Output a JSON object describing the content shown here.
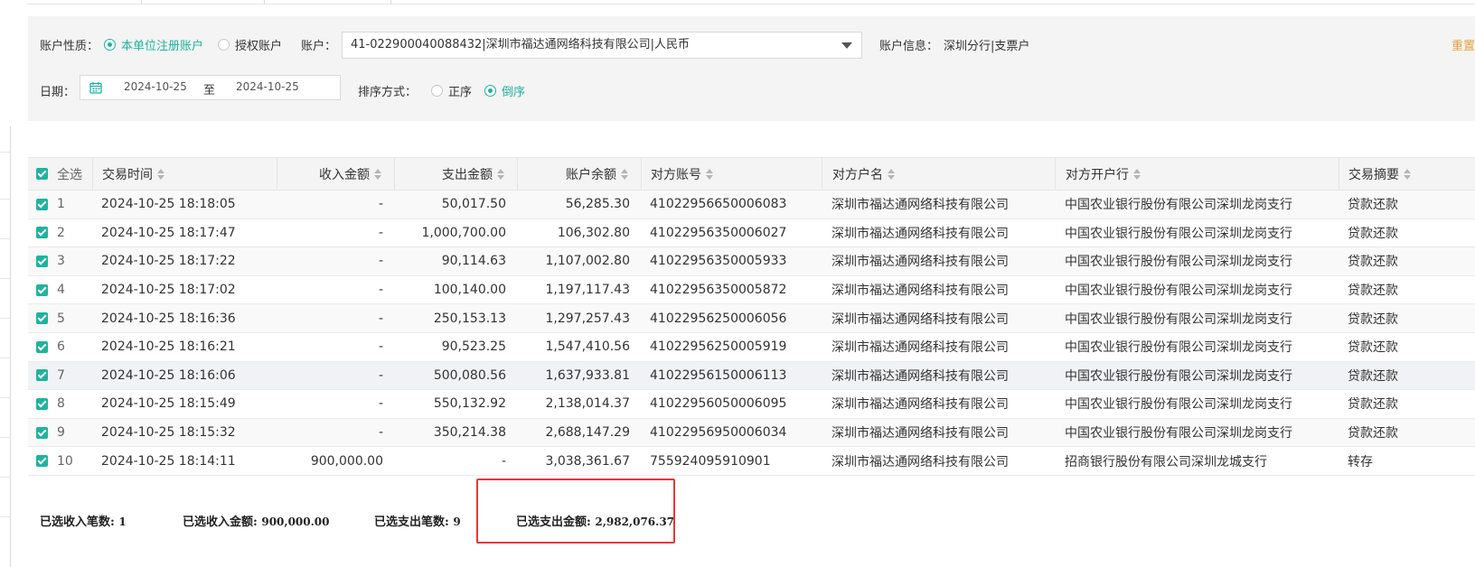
{
  "filters": {
    "account_type_label": "账户性质：",
    "account_type_options": [
      {
        "label": "本单位注册账户",
        "selected": true
      },
      {
        "label": "授权账户",
        "selected": false
      }
    ],
    "account_label": "账户：",
    "account_value": "41-022900040088432|深圳市福达通网络科技有限公司|人民币",
    "account_info_label": "账户信息：",
    "account_info_value": "深圳分行|支票户",
    "reset_label": "重置",
    "date_label": "日期：",
    "date_start": "2024-10-25",
    "date_to": "至",
    "date_end": "2024-10-25",
    "sort_label": "排序方式：",
    "sort_options": [
      {
        "label": "正序",
        "selected": false
      },
      {
        "label": "倒序",
        "selected": true
      }
    ]
  },
  "table": {
    "select_all_label": "全选",
    "columns": [
      "交易时间",
      "收入金额",
      "支出金额",
      "账户余额",
      "对方账号",
      "对方户名",
      "对方开户行",
      "交易摘要"
    ],
    "rows": [
      {
        "no": "1",
        "time": "2024-10-25 18:18:05",
        "income": "-",
        "expense": "50,017.50",
        "balance": "56,285.30",
        "acct": "41022956650006083",
        "name": "深圳市福达通网络科技有限公司",
        "bank": "中国农业银行股份有限公司深圳龙岗支行",
        "memo": "贷款还款"
      },
      {
        "no": "2",
        "time": "2024-10-25 18:17:47",
        "income": "-",
        "expense": "1,000,700.00",
        "balance": "106,302.80",
        "acct": "41022956350006027",
        "name": "深圳市福达通网络科技有限公司",
        "bank": "中国农业银行股份有限公司深圳龙岗支行",
        "memo": "贷款还款"
      },
      {
        "no": "3",
        "time": "2024-10-25 18:17:22",
        "income": "-",
        "expense": "90,114.63",
        "balance": "1,107,002.80",
        "acct": "41022956350005933",
        "name": "深圳市福达通网络科技有限公司",
        "bank": "中国农业银行股份有限公司深圳龙岗支行",
        "memo": "贷款还款"
      },
      {
        "no": "4",
        "time": "2024-10-25 18:17:02",
        "income": "-",
        "expense": "100,140.00",
        "balance": "1,197,117.43",
        "acct": "41022956350005872",
        "name": "深圳市福达通网络科技有限公司",
        "bank": "中国农业银行股份有限公司深圳龙岗支行",
        "memo": "贷款还款"
      },
      {
        "no": "5",
        "time": "2024-10-25 18:16:36",
        "income": "-",
        "expense": "250,153.13",
        "balance": "1,297,257.43",
        "acct": "41022956250006056",
        "name": "深圳市福达通网络科技有限公司",
        "bank": "中国农业银行股份有限公司深圳龙岗支行",
        "memo": "贷款还款"
      },
      {
        "no": "6",
        "time": "2024-10-25 18:16:21",
        "income": "-",
        "expense": "90,523.25",
        "balance": "1,547,410.56",
        "acct": "41022956250005919",
        "name": "深圳市福达通网络科技有限公司",
        "bank": "中国农业银行股份有限公司深圳龙岗支行",
        "memo": "贷款还款"
      },
      {
        "no": "7",
        "time": "2024-10-25 18:16:06",
        "income": "-",
        "expense": "500,080.56",
        "balance": "1,637,933.81",
        "acct": "41022956150006113",
        "name": "深圳市福达通网络科技有限公司",
        "bank": "中国农业银行股份有限公司深圳龙岗支行",
        "memo": "贷款还款"
      },
      {
        "no": "8",
        "time": "2024-10-25 18:15:49",
        "income": "-",
        "expense": "550,132.92",
        "balance": "2,138,014.37",
        "acct": "41022956050006095",
        "name": "深圳市福达通网络科技有限公司",
        "bank": "中国农业银行股份有限公司深圳龙岗支行",
        "memo": "贷款还款"
      },
      {
        "no": "9",
        "time": "2024-10-25 18:15:32",
        "income": "-",
        "expense": "350,214.38",
        "balance": "2,688,147.29",
        "acct": "41022956950006034",
        "name": "深圳市福达通网络科技有限公司",
        "bank": "中国农业银行股份有限公司深圳龙岗支行",
        "memo": "贷款还款"
      },
      {
        "no": "10",
        "time": "2024-10-25 18:14:11",
        "income": "900,000.00",
        "expense": "-",
        "balance": "3,038,361.67",
        "acct": "755924095910901",
        "name": "深圳市福达通网络科技有限公司",
        "bank": "招商银行股份有限公司深圳龙城支行",
        "memo": "转存"
      }
    ]
  },
  "summary": {
    "income_count_label": "已选收入笔数:",
    "income_count": "1",
    "income_amount_label": "已选收入金额:",
    "income_amount": "900,000.00",
    "expense_count_label": "已选支出笔数:",
    "expense_count": "9",
    "expense_amount_label": "已选支出金额:",
    "expense_amount": "2,982,076.37"
  },
  "colors": {
    "accent": "#1fb39e",
    "reset": "#e6a23c",
    "highlight": "#e53935"
  }
}
